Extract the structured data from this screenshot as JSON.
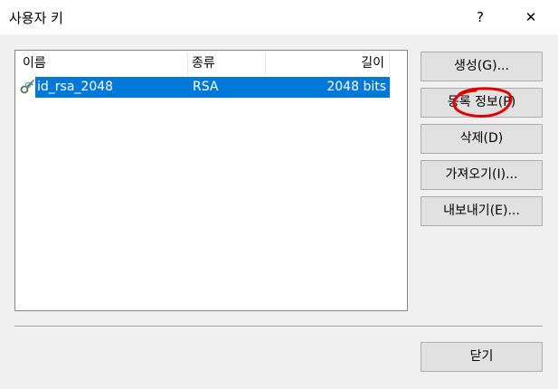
{
  "window": {
    "title": "사용자 키",
    "help_label": "?",
    "close_label": "✕"
  },
  "list": {
    "columns": [
      "이름",
      "종류",
      "길이"
    ],
    "rows": [
      {
        "name": "id_rsa_2048",
        "type": "RSA",
        "length": "2048 bits",
        "selected": true,
        "icon": "key-pair-icon"
      }
    ]
  },
  "buttons": {
    "generate": "생성(G)...",
    "info": "등록 정보(P)",
    "delete": "삭제(D)",
    "import": "가져오기(I)...",
    "export": "내보내기(E)...",
    "close": "닫기"
  },
  "colors": {
    "selection": "#0078d7",
    "annotation": "#e00000"
  }
}
